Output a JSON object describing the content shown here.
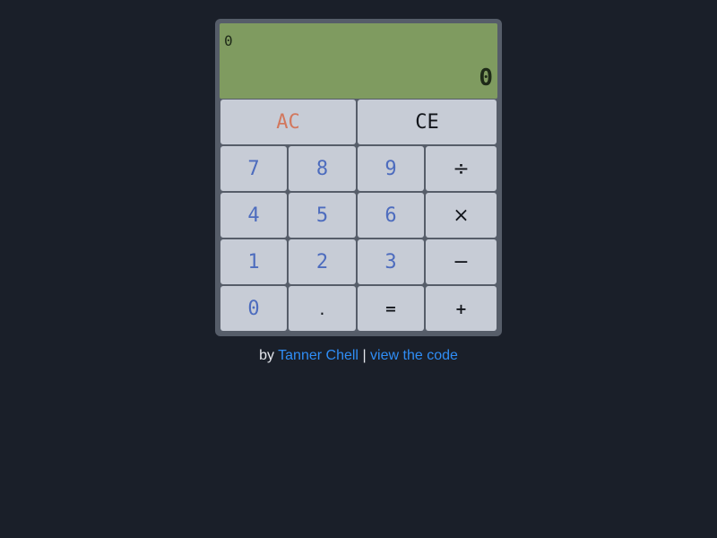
{
  "display": {
    "history": "0",
    "current": "0"
  },
  "keys": {
    "ac": "AC",
    "ce": "CE",
    "seven": "7",
    "eight": "8",
    "nine": "9",
    "divide": "÷",
    "four": "4",
    "five": "5",
    "six": "6",
    "multiply": "×",
    "one": "1",
    "two": "2",
    "three": "3",
    "subtract": "−",
    "zero": "0",
    "decimal": ".",
    "equals": "=",
    "add": "+"
  },
  "credit": {
    "by": "by",
    "author": "Tanner Chell",
    "separator": "|",
    "code_link": "view the code"
  },
  "colors": {
    "background": "#1a1f29",
    "body": "#565d69",
    "display": "#7f9b60",
    "key": "#c7ccd6",
    "digit_text": "#4d6cbe",
    "ac_text": "#d2785e",
    "link": "#2f8df5"
  }
}
